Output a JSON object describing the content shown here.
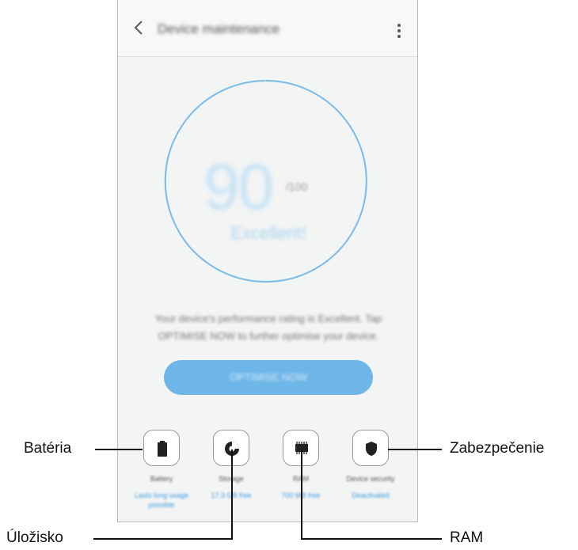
{
  "header": {
    "title": "Device maintenance"
  },
  "score": {
    "value": "90",
    "out_of": "/100",
    "status": "Excellent!"
  },
  "description": "Your device's performance rating is Excellent. Tap OPTIMISE NOW to further optimise your device.",
  "optimize_label": "OPTIMISE NOW",
  "tiles": [
    {
      "name": "Battery",
      "sub": "Lasts long usage possible",
      "icon": "battery-icon"
    },
    {
      "name": "Storage",
      "sub": "17.3 GB free",
      "icon": "storage-icon"
    },
    {
      "name": "RAM",
      "sub": "700 MB free",
      "icon": "ram-icon"
    },
    {
      "name": "Device security",
      "sub": "Deactivated",
      "icon": "shield-icon"
    }
  ],
  "callouts": {
    "battery": "Batéria",
    "storage": "Úložisko",
    "ram": "RAM",
    "security": "Zabezpečenie"
  },
  "colors": {
    "accent": "#6eb6e8",
    "ring": "#7dbde9"
  }
}
